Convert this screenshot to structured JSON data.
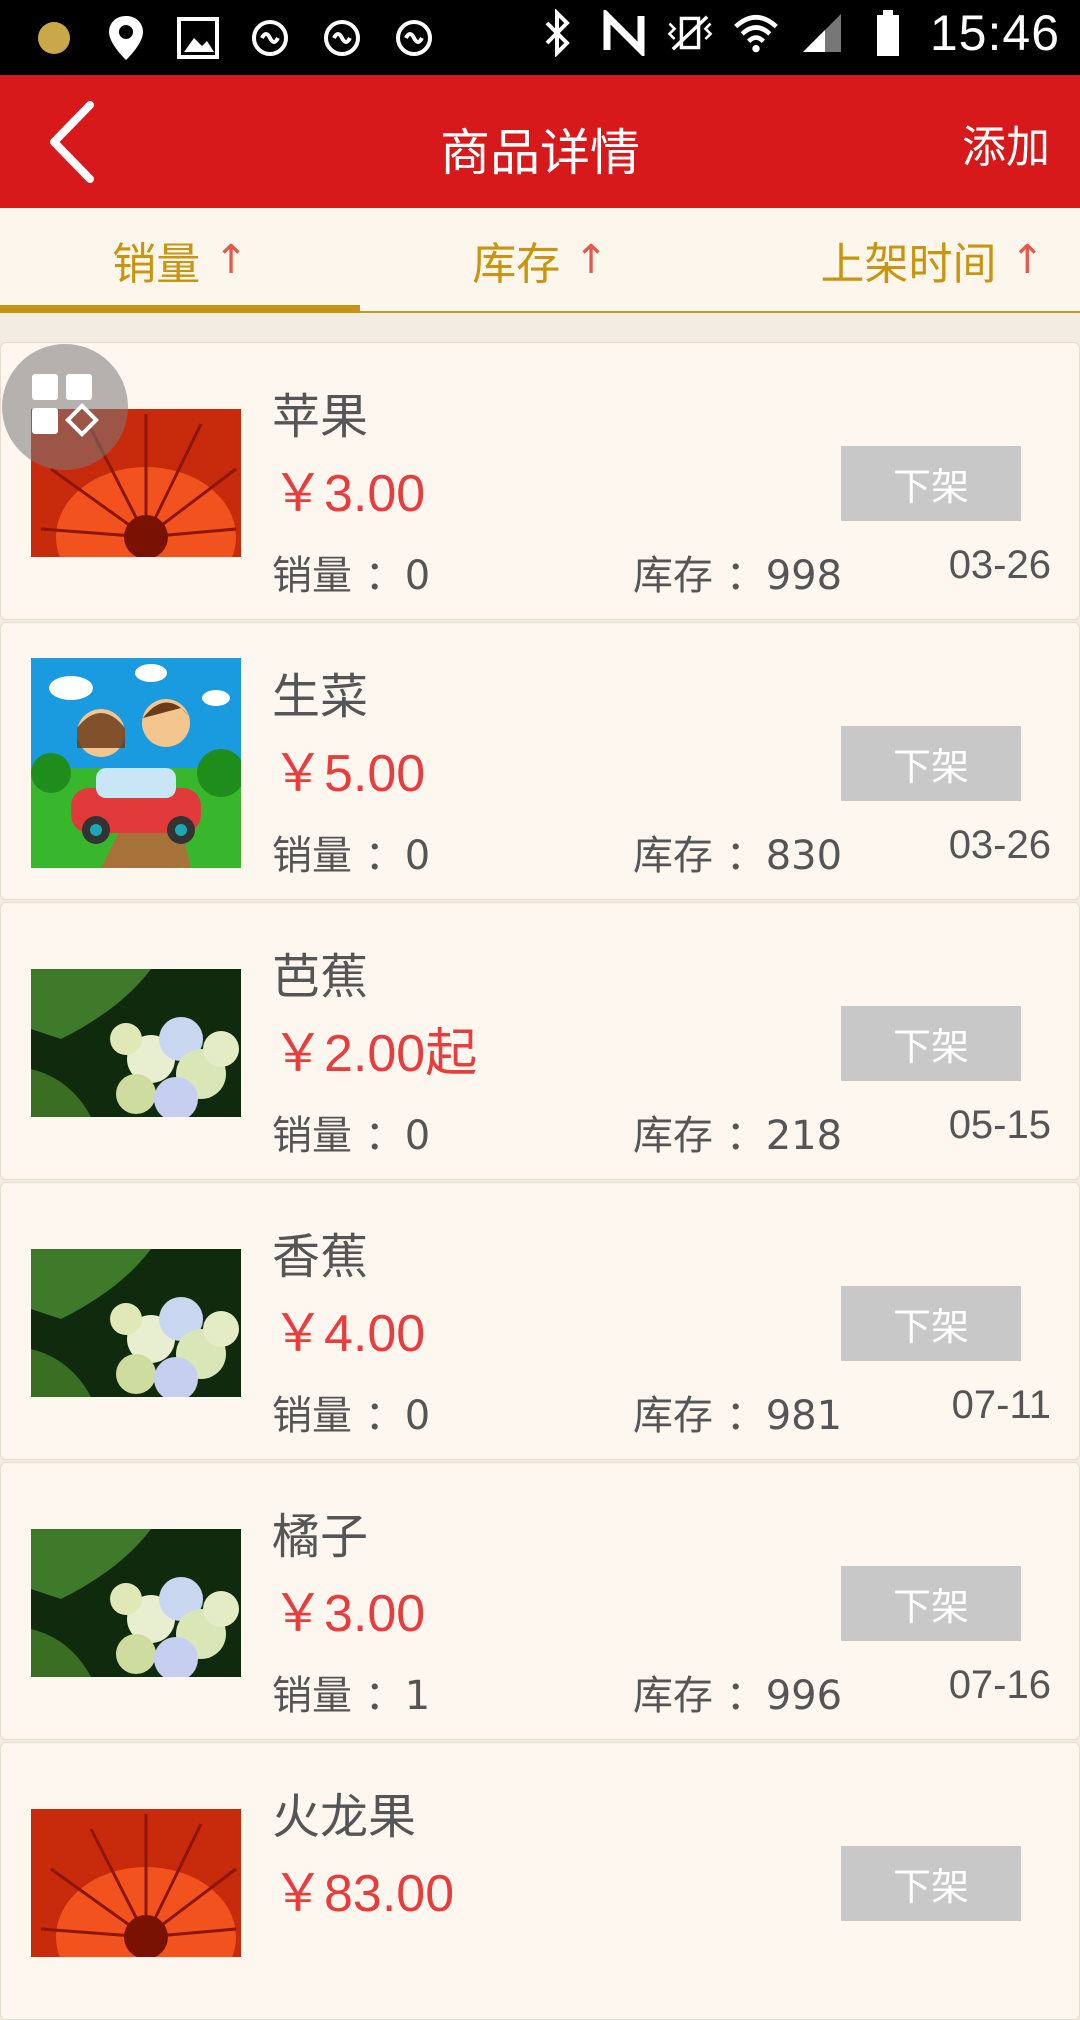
{
  "status_bar": {
    "time": "15:46",
    "icons_left": [
      "notification-dot-icon",
      "location-icon",
      "image-icon",
      "link-icon",
      "link-icon",
      "link-icon"
    ],
    "icons_right": [
      "bluetooth-icon",
      "nfc-icon",
      "vibrate-icon",
      "wifi-icon",
      "signal-icon",
      "battery-icon"
    ]
  },
  "header": {
    "title": "商品详情",
    "add_label": "添加"
  },
  "tabs": [
    {
      "label": "销量",
      "arrow": "↑"
    },
    {
      "label": "库存",
      "arrow": "↑"
    },
    {
      "label": "上架时间",
      "arrow": "↑"
    }
  ],
  "products": [
    {
      "name": "苹果",
      "price": "￥3.00",
      "sales": "销量 ：0",
      "stock": "库存 ：998",
      "date": "03-26",
      "button": "下架",
      "image": "red-flower"
    },
    {
      "name": "生菜",
      "price": "￥5.00",
      "sales": "销量 ：0",
      "stock": "库存 ：830",
      "date": "03-26",
      "button": "下架",
      "image": "cartoon-car"
    },
    {
      "name": "芭蕉",
      "price": "￥2.00起",
      "sales": "销量 ：0",
      "stock": "库存 ：218",
      "date": "05-15",
      "button": "下架",
      "image": "hydrangea"
    },
    {
      "name": "香蕉",
      "price": "￥4.00",
      "sales": "销量 ：0",
      "stock": "库存 ：981",
      "date": "07-11",
      "button": "下架",
      "image": "hydrangea"
    },
    {
      "name": "橘子",
      "price": "￥3.00",
      "sales": "销量 ：1",
      "stock": "库存 ：996",
      "date": "07-16",
      "button": "下架",
      "image": "hydrangea"
    },
    {
      "name": "火龙果",
      "price": "￥83.00",
      "sales": "",
      "stock": "",
      "date": "",
      "button": "下架",
      "image": "red-flower"
    }
  ],
  "colors": {
    "header": "#d7191b",
    "tab_text": "#c9940e",
    "price": "#e83d3d",
    "off_button": "#c8c8c8"
  }
}
